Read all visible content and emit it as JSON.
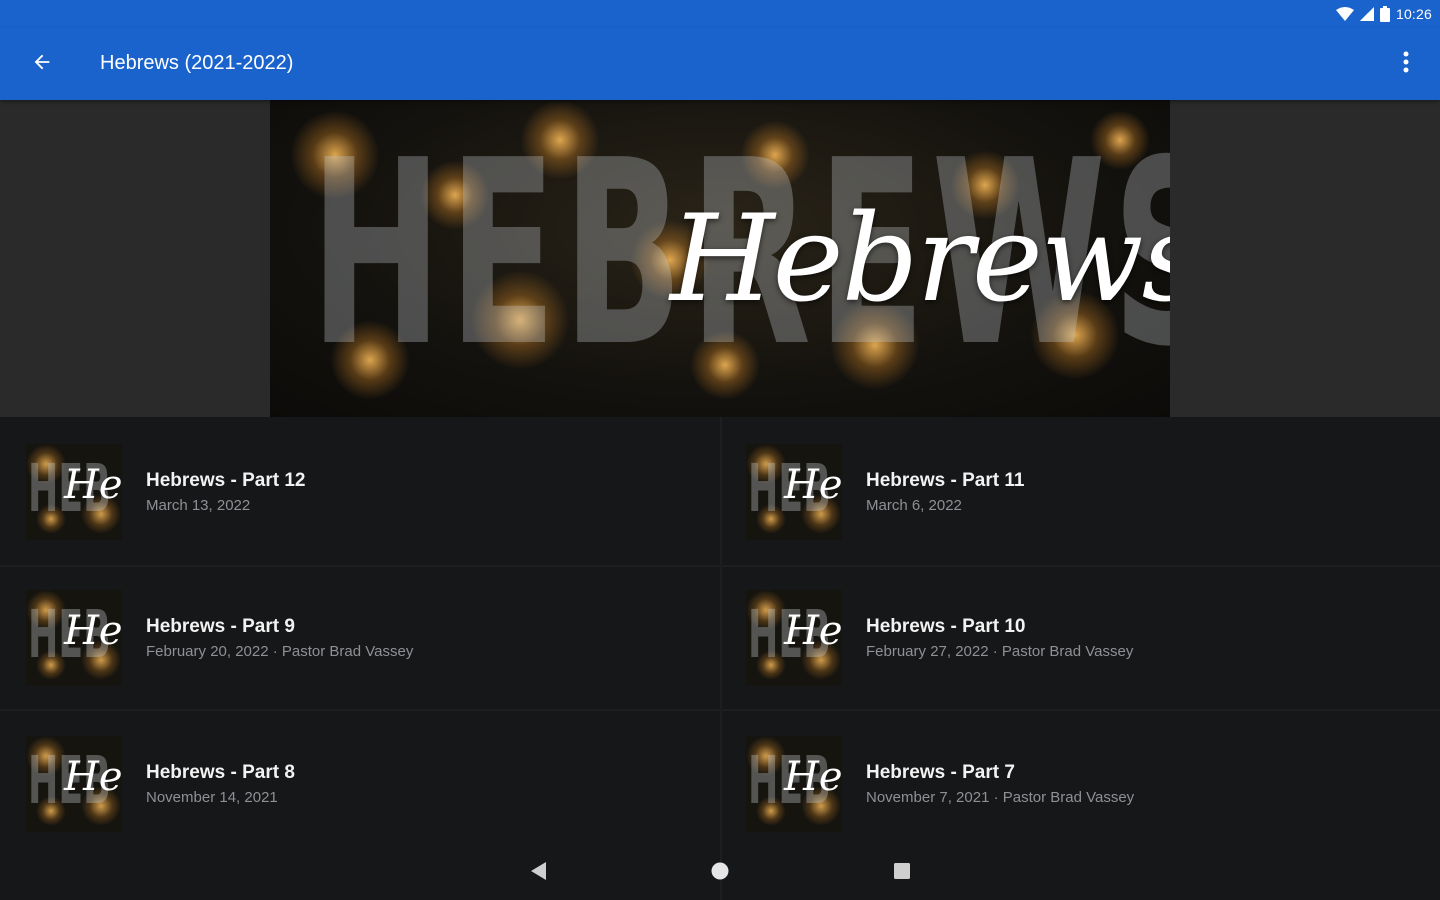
{
  "status_bar": {
    "time": "10:26",
    "icons": [
      "wifi-icon",
      "signal-icon",
      "battery-icon"
    ]
  },
  "app_bar": {
    "title": "Hebrews (2021-2022)",
    "back_icon": "arrow-left-icon",
    "menu_icon": "more-vert-icon"
  },
  "banner": {
    "block_text": "HEBREWS",
    "script_text": "Hebrews"
  },
  "sermons": [
    {
      "title": "Hebrews - Part 12",
      "subtitle": "March 13, 2022"
    },
    {
      "title": "Hebrews - Part 11",
      "subtitle": "March 6, 2022"
    },
    {
      "title": "Hebrews - Part 9",
      "subtitle": "February 20, 2022 · Pastor Brad Vassey"
    },
    {
      "title": "Hebrews - Part 10",
      "subtitle": "February 27, 2022 · Pastor Brad Vassey"
    },
    {
      "title": "Hebrews - Part 8",
      "subtitle": "November 14, 2021"
    },
    {
      "title": "Hebrews - Part 7",
      "subtitle": "November 7, 2021 · Pastor Brad Vassey"
    }
  ],
  "thumb": {
    "block_text": "HEB",
    "script_text": "Heb"
  },
  "nav_bar": {
    "icons": [
      "nav-back-icon",
      "nav-home-icon",
      "nav-recents-icon"
    ]
  },
  "colors": {
    "primary": "#1a63cc",
    "background": "#161719",
    "banner_side": "#2a2a2b",
    "title_text": "#f2f2f2",
    "subtitle_text": "#8e9094"
  }
}
